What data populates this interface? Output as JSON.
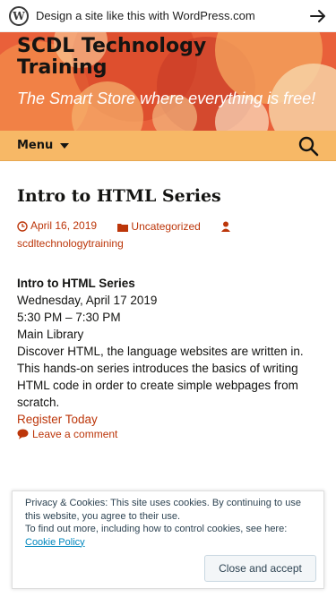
{
  "wp_bar": {
    "text": "Design a site like this with WordPress.com",
    "logo_icon": "wordpress-logo-icon",
    "arrow_icon": "arrow-right-icon"
  },
  "header": {
    "title": "SCDL Technology Training",
    "description": "The Smart Store where everything is free!"
  },
  "nav": {
    "menu_label": "Menu",
    "search_icon": "search-icon"
  },
  "post": {
    "title": "Intro to HTML Series",
    "date": "April 16, 2019",
    "category": "Uncategorized",
    "author": "scdltechnologytraining",
    "body_title": "Intro to HTML Series",
    "event_date": "Wednesday, April 17 2019",
    "event_time": "5:30 PM – 7:30 PM",
    "location": "Main Library",
    "description": "Discover HTML, the language websites are written in. This hands-on series introduces the basics of writing HTML code in order to create simple webpages from scratch.",
    "register_link": "Register Today",
    "comment_link": "Leave a comment"
  },
  "cookie_banner": {
    "text1": "Privacy & Cookies: This site uses cookies. By continuing to use this website, you agree to their use.",
    "text2": "To find out more, including how to control cookies, see here:",
    "policy_link": "Cookie Policy",
    "accept_button": "Close and accept"
  },
  "colors": {
    "accent": "#bc360a",
    "navbar": "#f7b866",
    "header_bg": "#e8572e"
  }
}
